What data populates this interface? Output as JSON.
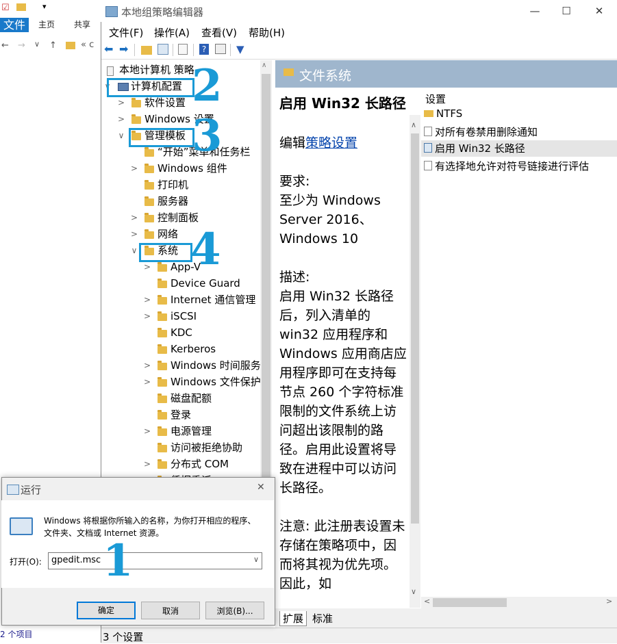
{
  "explorer": {
    "ribbon_tabs": [
      "文件",
      "主页",
      "共享"
    ],
    "address_text": "« c",
    "status_text": "2 个项目"
  },
  "window": {
    "title": "本地组策略编辑器",
    "controls": {
      "minimize": "—",
      "maximize": "☐",
      "close": "✕"
    },
    "menu": [
      "文件(F)",
      "操作(A)",
      "查看(V)",
      "帮助(H)"
    ]
  },
  "tree": [
    {
      "label": "本地计算机 策略",
      "indent": 0
    },
    {
      "label": "计算机配置",
      "indent": 0
    },
    {
      "label": "软件设置",
      "indent": 1
    },
    {
      "label": "Windows 设置",
      "indent": 1
    },
    {
      "label": "管理模板",
      "indent": 1
    },
    {
      "label": "“开始”菜单和任务栏",
      "indent": 2
    },
    {
      "label": "Windows 组件",
      "indent": 2
    },
    {
      "label": "打印机",
      "indent": 2
    },
    {
      "label": "服务器",
      "indent": 2
    },
    {
      "label": "控制面板",
      "indent": 2
    },
    {
      "label": "网络",
      "indent": 2
    },
    {
      "label": "系统",
      "indent": 2
    },
    {
      "label": "App-V",
      "indent": 3
    },
    {
      "label": "Device Guard",
      "indent": 3
    },
    {
      "label": "Internet 通信管理",
      "indent": 3
    },
    {
      "label": "iSCSI",
      "indent": 3
    },
    {
      "label": "KDC",
      "indent": 3
    },
    {
      "label": "Kerberos",
      "indent": 3
    },
    {
      "label": "Windows 时间服务",
      "indent": 3
    },
    {
      "label": "Windows 文件保护",
      "indent": 3
    },
    {
      "label": "磁盘配额",
      "indent": 3
    },
    {
      "label": "登录",
      "indent": 3
    },
    {
      "label": "电源管理",
      "indent": 3
    },
    {
      "label": "访问被拒绝协助",
      "indent": 3
    },
    {
      "label": "分布式 COM",
      "indent": 3
    },
    {
      "label": "凭据委派",
      "indent": 3
    }
  ],
  "detail": {
    "header": "文件系统",
    "policy_title": "启用 Win32 长路径",
    "edit_prefix": "编辑",
    "edit_link": "策略设置",
    "req_heading": "要求:",
    "req_text": "至少为 Windows Server 2016、Windows 10",
    "desc_heading": "描述:",
    "desc_text": "启用 Win32 长路径后，列入清单的 win32 应用程序和 Windows 应用商店应用程序即可在支持每节点 260 个字符标准限制的文件系统上访问超出该限制的路径。启用此设置将导致在进程中可以访问长路径。",
    "note_text": "注意: 此注册表设置未存储在策略项中，因而将其视为优先项。因此，如",
    "list_header": "设置",
    "list_items": [
      "NTFS",
      "对所有卷禁用删除通知",
      "启用 Win32 长路径",
      "有选择地允许对符号链接进行评估"
    ],
    "tabs": [
      "扩展",
      "标准"
    ]
  },
  "status": "3 个设置",
  "annotations": [
    "1",
    "2",
    "3",
    "4"
  ],
  "run_dialog": {
    "title": "运行",
    "description": "Windows 将根据你所输入的名称，为你打开相应的程序、文件夹、文档或 Internet 资源。",
    "open_label": "打开(O):",
    "input_value": "gpedit.msc",
    "ok": "确定",
    "cancel": "取消",
    "browse": "浏览(B)...",
    "close": "✕"
  },
  "colors": {
    "accent": "#1a9ad6",
    "header_bar": "#9fb6cd",
    "folder": "#e8bb48",
    "explorer_file_tab": "#1979ca"
  }
}
